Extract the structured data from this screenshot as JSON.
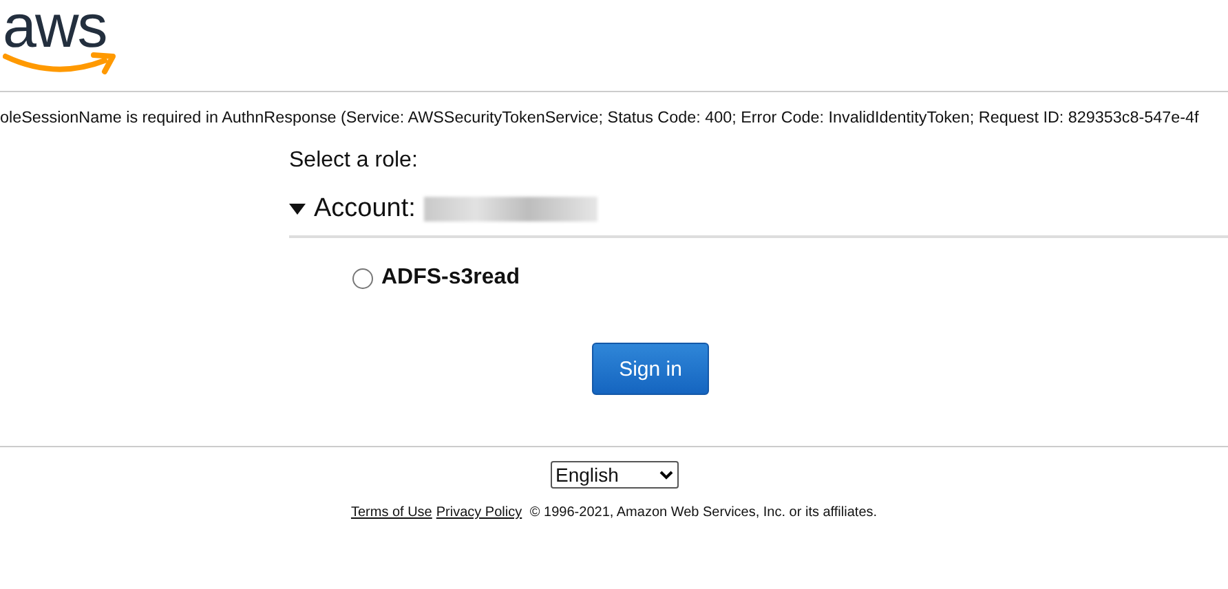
{
  "logo": {
    "text": "aws"
  },
  "error_message": "oleSessionName is required in AuthnResponse (Service: AWSSecurityTokenService; Status Code: 400; Error Code: InvalidIdentityToken; Request ID: 829353c8-547e-4f",
  "heading": "Select a role:",
  "account": {
    "label": "Account:",
    "expanded": true,
    "roles": [
      {
        "label": "ADFS-s3read",
        "selected": false
      }
    ]
  },
  "sign_in_button": "Sign in",
  "language_select": {
    "value": "English"
  },
  "footer": {
    "links": [
      "Terms of Use",
      "Privacy Policy"
    ],
    "text": "© 1996-2021, Amazon Web Services, Inc. or its affiliates."
  }
}
